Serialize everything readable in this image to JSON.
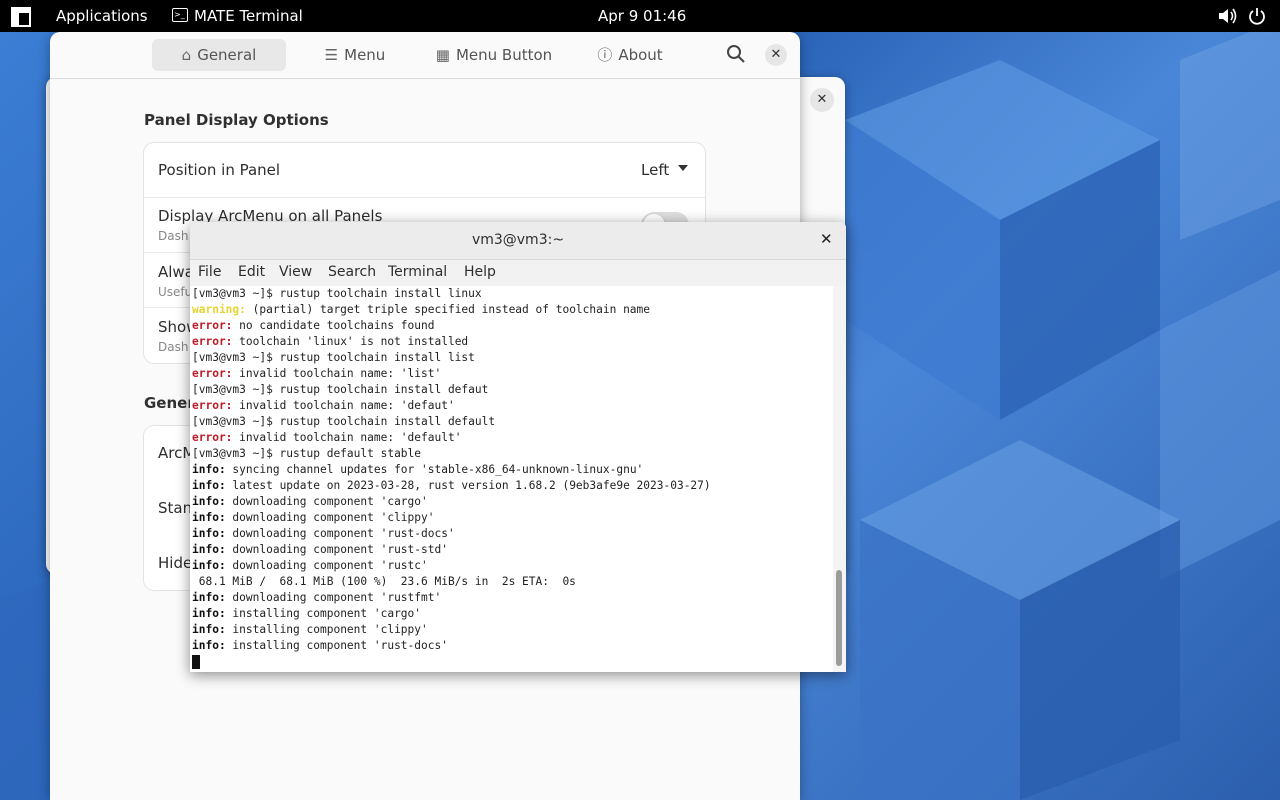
{
  "topbar": {
    "apps_label": "Applications",
    "active_app": "MATE Terminal",
    "clock": "Apr 9  01:46",
    "icons": [
      "apps-grid-icon",
      "terminal-icon",
      "volume-icon",
      "power-icon"
    ]
  },
  "prefs": {
    "tabs": [
      {
        "label": "General",
        "icon": "home-icon"
      },
      {
        "label": "Menu",
        "icon": "menu-list-icon"
      },
      {
        "label": "Menu Button",
        "icon": "menu-button-icon"
      },
      {
        "label": "About",
        "icon": "info-icon"
      }
    ],
    "section_title": "Panel Display Options",
    "rows": [
      {
        "title": "Position in Panel",
        "value": "Left"
      },
      {
        "title": "Display ArcMenu on all Panels",
        "subtitle": "Dash"
      },
      {
        "title": "Alwa",
        "subtitle": "Usefu"
      },
      {
        "title": "Show",
        "subtitle": "Dash"
      }
    ],
    "section2_title": "Genera",
    "rows2": [
      "ArcM",
      "Stand",
      "Hide"
    ]
  },
  "terminal": {
    "title": "vm3@vm3:~",
    "menu": [
      "File",
      "Edit",
      "View",
      "Search",
      "Terminal",
      "Help"
    ],
    "lines": [
      {
        "prefix": "",
        "text": "[vm3@vm3 ~]$ rustup toolchain install linux"
      },
      {
        "prefix": "warning:",
        "kind": "warn",
        "text": " (partial) target triple specified instead of toolchain name"
      },
      {
        "prefix": "error:",
        "kind": "err",
        "text": " no candidate toolchains found"
      },
      {
        "prefix": "error:",
        "kind": "err",
        "text": " toolchain 'linux' is not installed"
      },
      {
        "prefix": "",
        "text": "[vm3@vm3 ~]$ rustup toolchain install list"
      },
      {
        "prefix": "error:",
        "kind": "err",
        "text": " invalid toolchain name: 'list'"
      },
      {
        "prefix": "",
        "text": "[vm3@vm3 ~]$ rustup toolchain install defaut"
      },
      {
        "prefix": "error:",
        "kind": "err",
        "text": " invalid toolchain name: 'defaut'"
      },
      {
        "prefix": "",
        "text": "[vm3@vm3 ~]$ rustup toolchain install default"
      },
      {
        "prefix": "error:",
        "kind": "err",
        "text": " invalid toolchain name: 'default'"
      },
      {
        "prefix": "",
        "text": "[vm3@vm3 ~]$ rustup default stable"
      },
      {
        "prefix": "info:",
        "kind": "info",
        "text": " syncing channel updates for 'stable-x86_64-unknown-linux-gnu'"
      },
      {
        "prefix": "info:",
        "kind": "info",
        "text": " latest update on 2023-03-28, rust version 1.68.2 (9eb3afe9e 2023-03-27)"
      },
      {
        "prefix": "info:",
        "kind": "info",
        "text": " downloading component 'cargo'"
      },
      {
        "prefix": "info:",
        "kind": "info",
        "text": " downloading component 'clippy'"
      },
      {
        "prefix": "info:",
        "kind": "info",
        "text": " downloading component 'rust-docs'"
      },
      {
        "prefix": "info:",
        "kind": "info",
        "text": " downloading component 'rust-std'"
      },
      {
        "prefix": "info:",
        "kind": "info",
        "text": " downloading component 'rustc'"
      },
      {
        "prefix": "",
        "text": " 68.1 MiB /  68.1 MiB (100 %)  23.6 MiB/s in  2s ETA:  0s"
      },
      {
        "prefix": "info:",
        "kind": "info",
        "text": " downloading component 'rustfmt'"
      },
      {
        "prefix": "info:",
        "kind": "info",
        "text": " installing component 'cargo'"
      },
      {
        "prefix": "info:",
        "kind": "info",
        "text": " installing component 'clippy'"
      },
      {
        "prefix": "info:",
        "kind": "info",
        "text": " installing component 'rust-docs'"
      }
    ]
  },
  "colors": {
    "error": "#c01c28",
    "warning": "#e5d433",
    "topbar": "#000000",
    "desktop": "#2f6fc2"
  }
}
